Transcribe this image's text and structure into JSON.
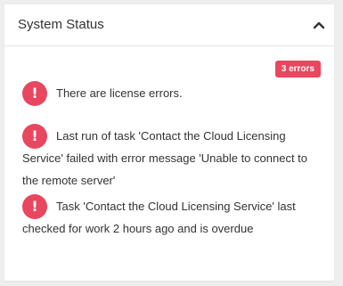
{
  "panel": {
    "title": "System Status",
    "badge": "3 errors",
    "colors": {
      "error": "#e8475f",
      "text": "#333333",
      "background": "#ffffff",
      "page_background": "#eeeeee",
      "divider": "#e5e5e5"
    }
  },
  "alerts": [
    {
      "icon": "exclamation-icon",
      "icon_glyph": "!",
      "text": "There are license errors."
    },
    {
      "icon": "exclamation-icon",
      "icon_glyph": "!",
      "text": "Last run of task 'Contact the Cloud Licensing Service' failed with error message 'Unable to connect to the remote server'"
    },
    {
      "icon": "exclamation-icon",
      "icon_glyph": "!",
      "text": "Task 'Contact the Cloud Licensing Service' last checked for work 2 hours ago and is overdue"
    }
  ]
}
